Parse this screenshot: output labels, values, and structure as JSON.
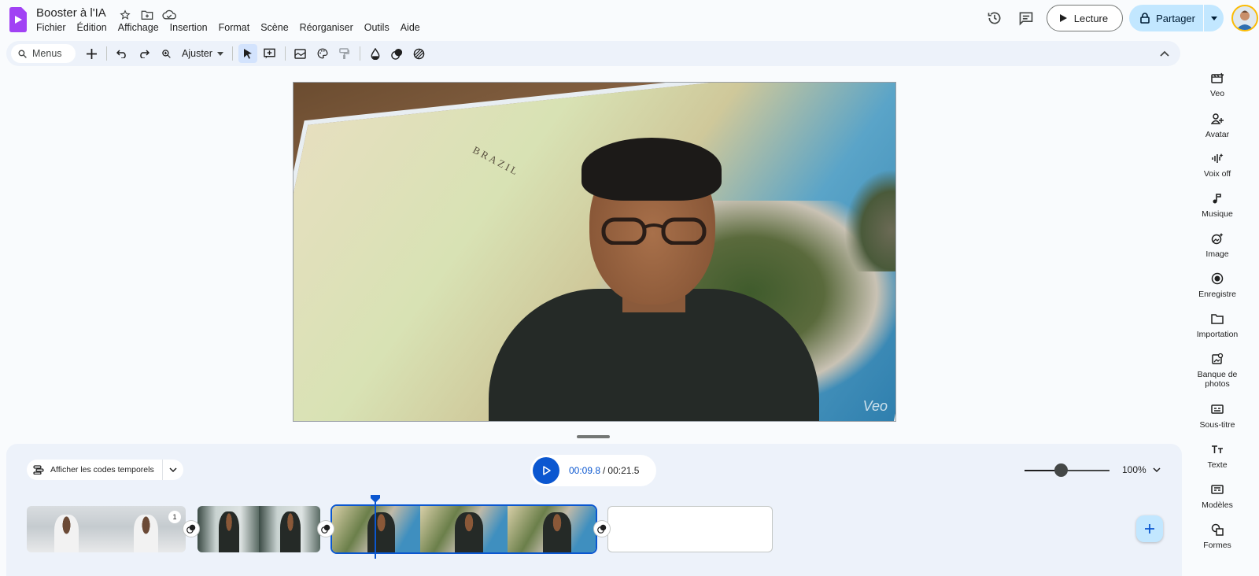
{
  "header": {
    "doc_title": "Booster à l'IA",
    "menu": [
      "Fichier",
      "Édition",
      "Affichage",
      "Insertion",
      "Format",
      "Scène",
      "Réorganiser",
      "Outils",
      "Aide"
    ],
    "play_label": "Lecture",
    "share_label": "Partager"
  },
  "toolbar": {
    "search_label": "Menus",
    "zoom_label": "Ajuster"
  },
  "canvas": {
    "map_text": "BRAZIL",
    "watermark": "Veo"
  },
  "sidebar": {
    "items": [
      {
        "label": "Veo",
        "icon": "veo-clip-icon"
      },
      {
        "label": "Avatar",
        "icon": "avatar-add-icon"
      },
      {
        "label": "Voix off",
        "icon": "voiceover-icon"
      },
      {
        "label": "Musique",
        "icon": "music-icon"
      },
      {
        "label": "Image",
        "icon": "image-spark-icon"
      },
      {
        "label": "Enregistre",
        "icon": "record-icon"
      },
      {
        "label": "Importation",
        "icon": "folder-icon"
      },
      {
        "label": "Banque de photos",
        "icon": "stock-photos-icon"
      },
      {
        "label": "Sous-titre",
        "icon": "subtitles-icon"
      },
      {
        "label": "Texte",
        "icon": "text-icon"
      },
      {
        "label": "Modèles",
        "icon": "templates-icon"
      },
      {
        "label": "Formes",
        "icon": "shapes-icon"
      }
    ]
  },
  "timeline": {
    "timecodes_label": "Afficher les codes temporels",
    "current_time": "00:09.8",
    "separator": "/",
    "total_time": "00:21.5",
    "zoom_percent": "100%",
    "zoom_level": 0.4,
    "clip1_badge": "1"
  },
  "colors": {
    "accent": "#0b57d0",
    "share_bg": "#c2e7ff",
    "toolbar_bg": "#edf2fa",
    "logo": "#a142f4"
  }
}
